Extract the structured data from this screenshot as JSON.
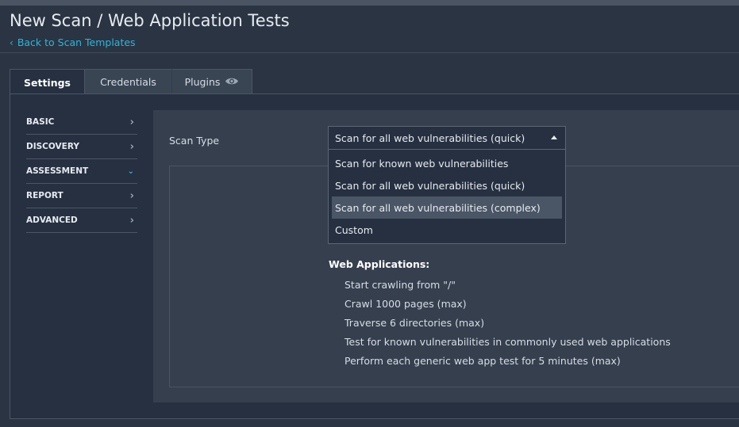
{
  "header": {
    "title": "New Scan / Web Application Tests",
    "back_link": "Back to Scan Templates"
  },
  "tabs": [
    {
      "label": "Settings",
      "active": true
    },
    {
      "label": "Credentials",
      "active": false
    },
    {
      "label": "Plugins",
      "active": false,
      "icon": "eye-icon"
    }
  ],
  "sidebar": {
    "items": [
      {
        "label": "BASIC",
        "expanded": false
      },
      {
        "label": "DISCOVERY",
        "expanded": false
      },
      {
        "label": "ASSESSMENT",
        "expanded": true
      },
      {
        "label": "REPORT",
        "expanded": false
      },
      {
        "label": "ADVANCED",
        "expanded": false
      }
    ]
  },
  "assessment": {
    "scan_type_label": "Scan Type",
    "selected": "Scan for all web vulnerabilities (quick)",
    "options": [
      "Scan for known web vulnerabilities",
      "Scan for all web vulnerabilities (quick)",
      "Scan for all web vulnerabilities (complex)",
      "Custom"
    ],
    "highlighted_option": "Scan for all web vulnerabilities (complex)",
    "web_apps_title": "Web Applications:",
    "web_apps_items": [
      "Start crawling from \"/\"",
      "Crawl 1000 pages (max)",
      "Traverse 6 directories (max)",
      "Test for known vulnerabilities in commonly used web applications",
      "Perform each generic web app test for 5 minutes (max)"
    ]
  },
  "colors": {
    "background": "#2b3442",
    "panel": "#263040",
    "content": "#353f4e",
    "accent": "#2ab7dd"
  }
}
